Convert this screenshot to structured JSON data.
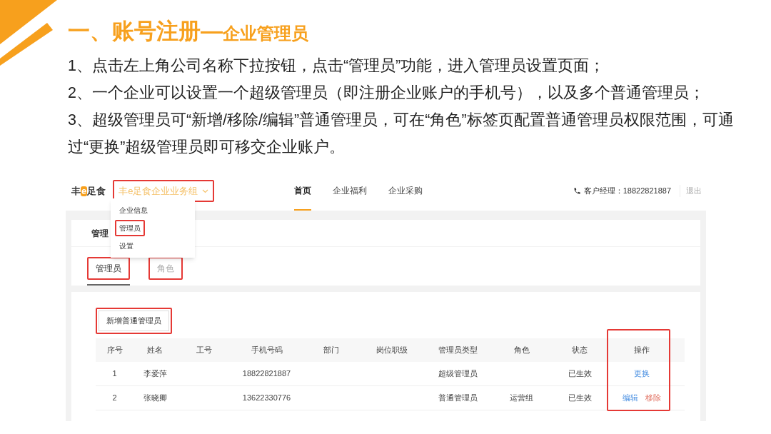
{
  "slide": {
    "title": "一、账号注册—",
    "subtitle": "企业管理员",
    "steps": [
      "1、点击左上角公司名称下拉按钮，点击“管理员”功能，进入管理员设置页面；",
      "2、一个企业可以设置一个超级管理员（即注册企业账户的手机号），以及多个普通管理员；",
      "3、超级管理员可“新增/移除/编辑”普通管理员，可在“角色”标签页配置普通管理员权限范围，可通过“更换”超级管理员即可移交企业账户。"
    ]
  },
  "app": {
    "logo": {
      "before": "丰",
      "mark": "e",
      "after": "足食"
    },
    "company_menu": {
      "label": "丰e足食企业业务组",
      "highlighted": true,
      "items": [
        {
          "label": "企业信息",
          "highlighted": false
        },
        {
          "label": "管理员",
          "highlighted": true
        },
        {
          "label": "设置",
          "highlighted": false
        }
      ]
    },
    "nav": [
      {
        "label": "首页",
        "selected": true
      },
      {
        "label": "企业福利",
        "selected": false
      },
      {
        "label": "企业采购",
        "selected": false
      }
    ],
    "manager": "客户经理：18822821887",
    "logout": "退出",
    "page_title": "管理",
    "tabs": [
      {
        "label": "管理员",
        "selected": true,
        "highlighted": true
      },
      {
        "label": "角色",
        "selected": false,
        "highlighted": true
      }
    ],
    "add_button": {
      "label": "新增普通管理员",
      "highlighted": true
    },
    "table": {
      "columns": [
        "序号",
        "姓名",
        "工号",
        "手机号码",
        "部门",
        "岗位职级",
        "管理员类型",
        "角色",
        "状态",
        "操作"
      ],
      "actions_highlighted": true,
      "rows": [
        {
          "index": "1",
          "name": "李爱萍",
          "phone": "18822821887",
          "admin_type": "超级管理员",
          "status": "已生效",
          "actions": [
            {
              "label": "更换",
              "kind": "primary"
            }
          ]
        },
        {
          "index": "2",
          "name": "张晓卿",
          "phone": "13622330776",
          "admin_type": "普通管理员",
          "role": "运营组",
          "status": "已生效",
          "actions": [
            {
              "label": "编辑",
              "kind": "primary"
            },
            {
              "label": "移除",
              "kind": "danger"
            }
          ]
        }
      ]
    }
  }
}
